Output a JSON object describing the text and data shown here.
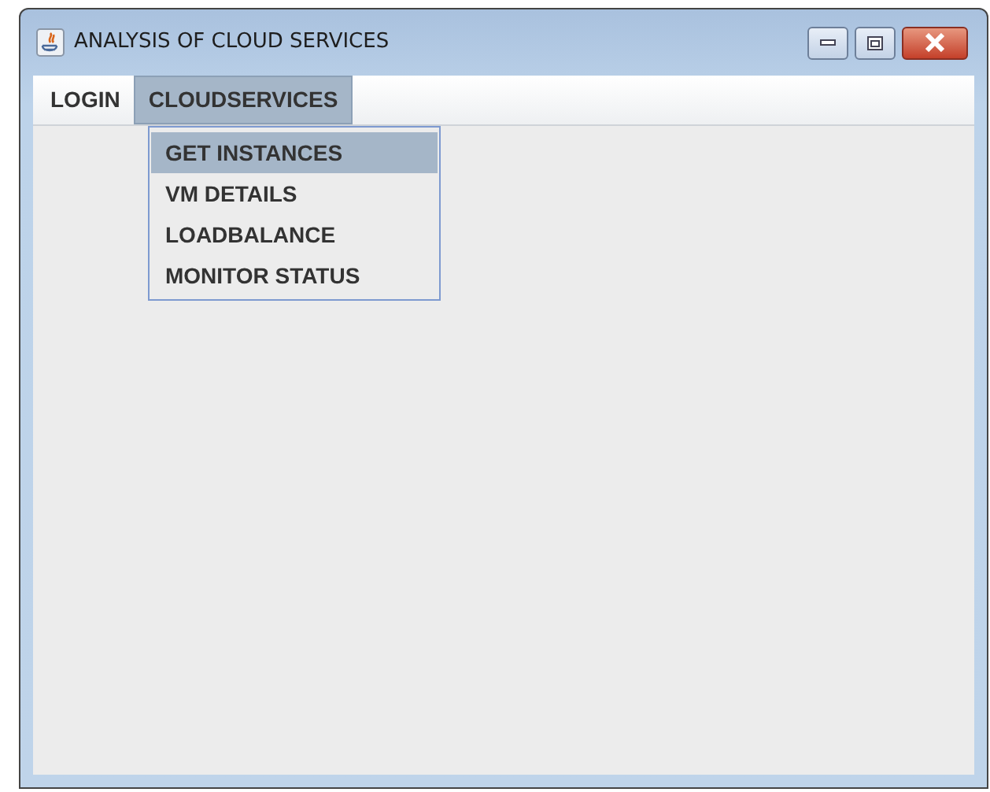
{
  "window": {
    "title": "ANALYSIS OF CLOUD SERVICES"
  },
  "menubar": [
    {
      "label": "LOGIN",
      "selected": false
    },
    {
      "label": "CLOUDSERVICES",
      "selected": true
    }
  ],
  "open_menu": {
    "items": [
      {
        "label": "GET INSTANCES",
        "selected": true
      },
      {
        "label": "VM DETAILS",
        "selected": false
      },
      {
        "label": "LOADBALANCE",
        "selected": false
      },
      {
        "label": "MONITOR STATUS",
        "selected": false
      }
    ]
  }
}
